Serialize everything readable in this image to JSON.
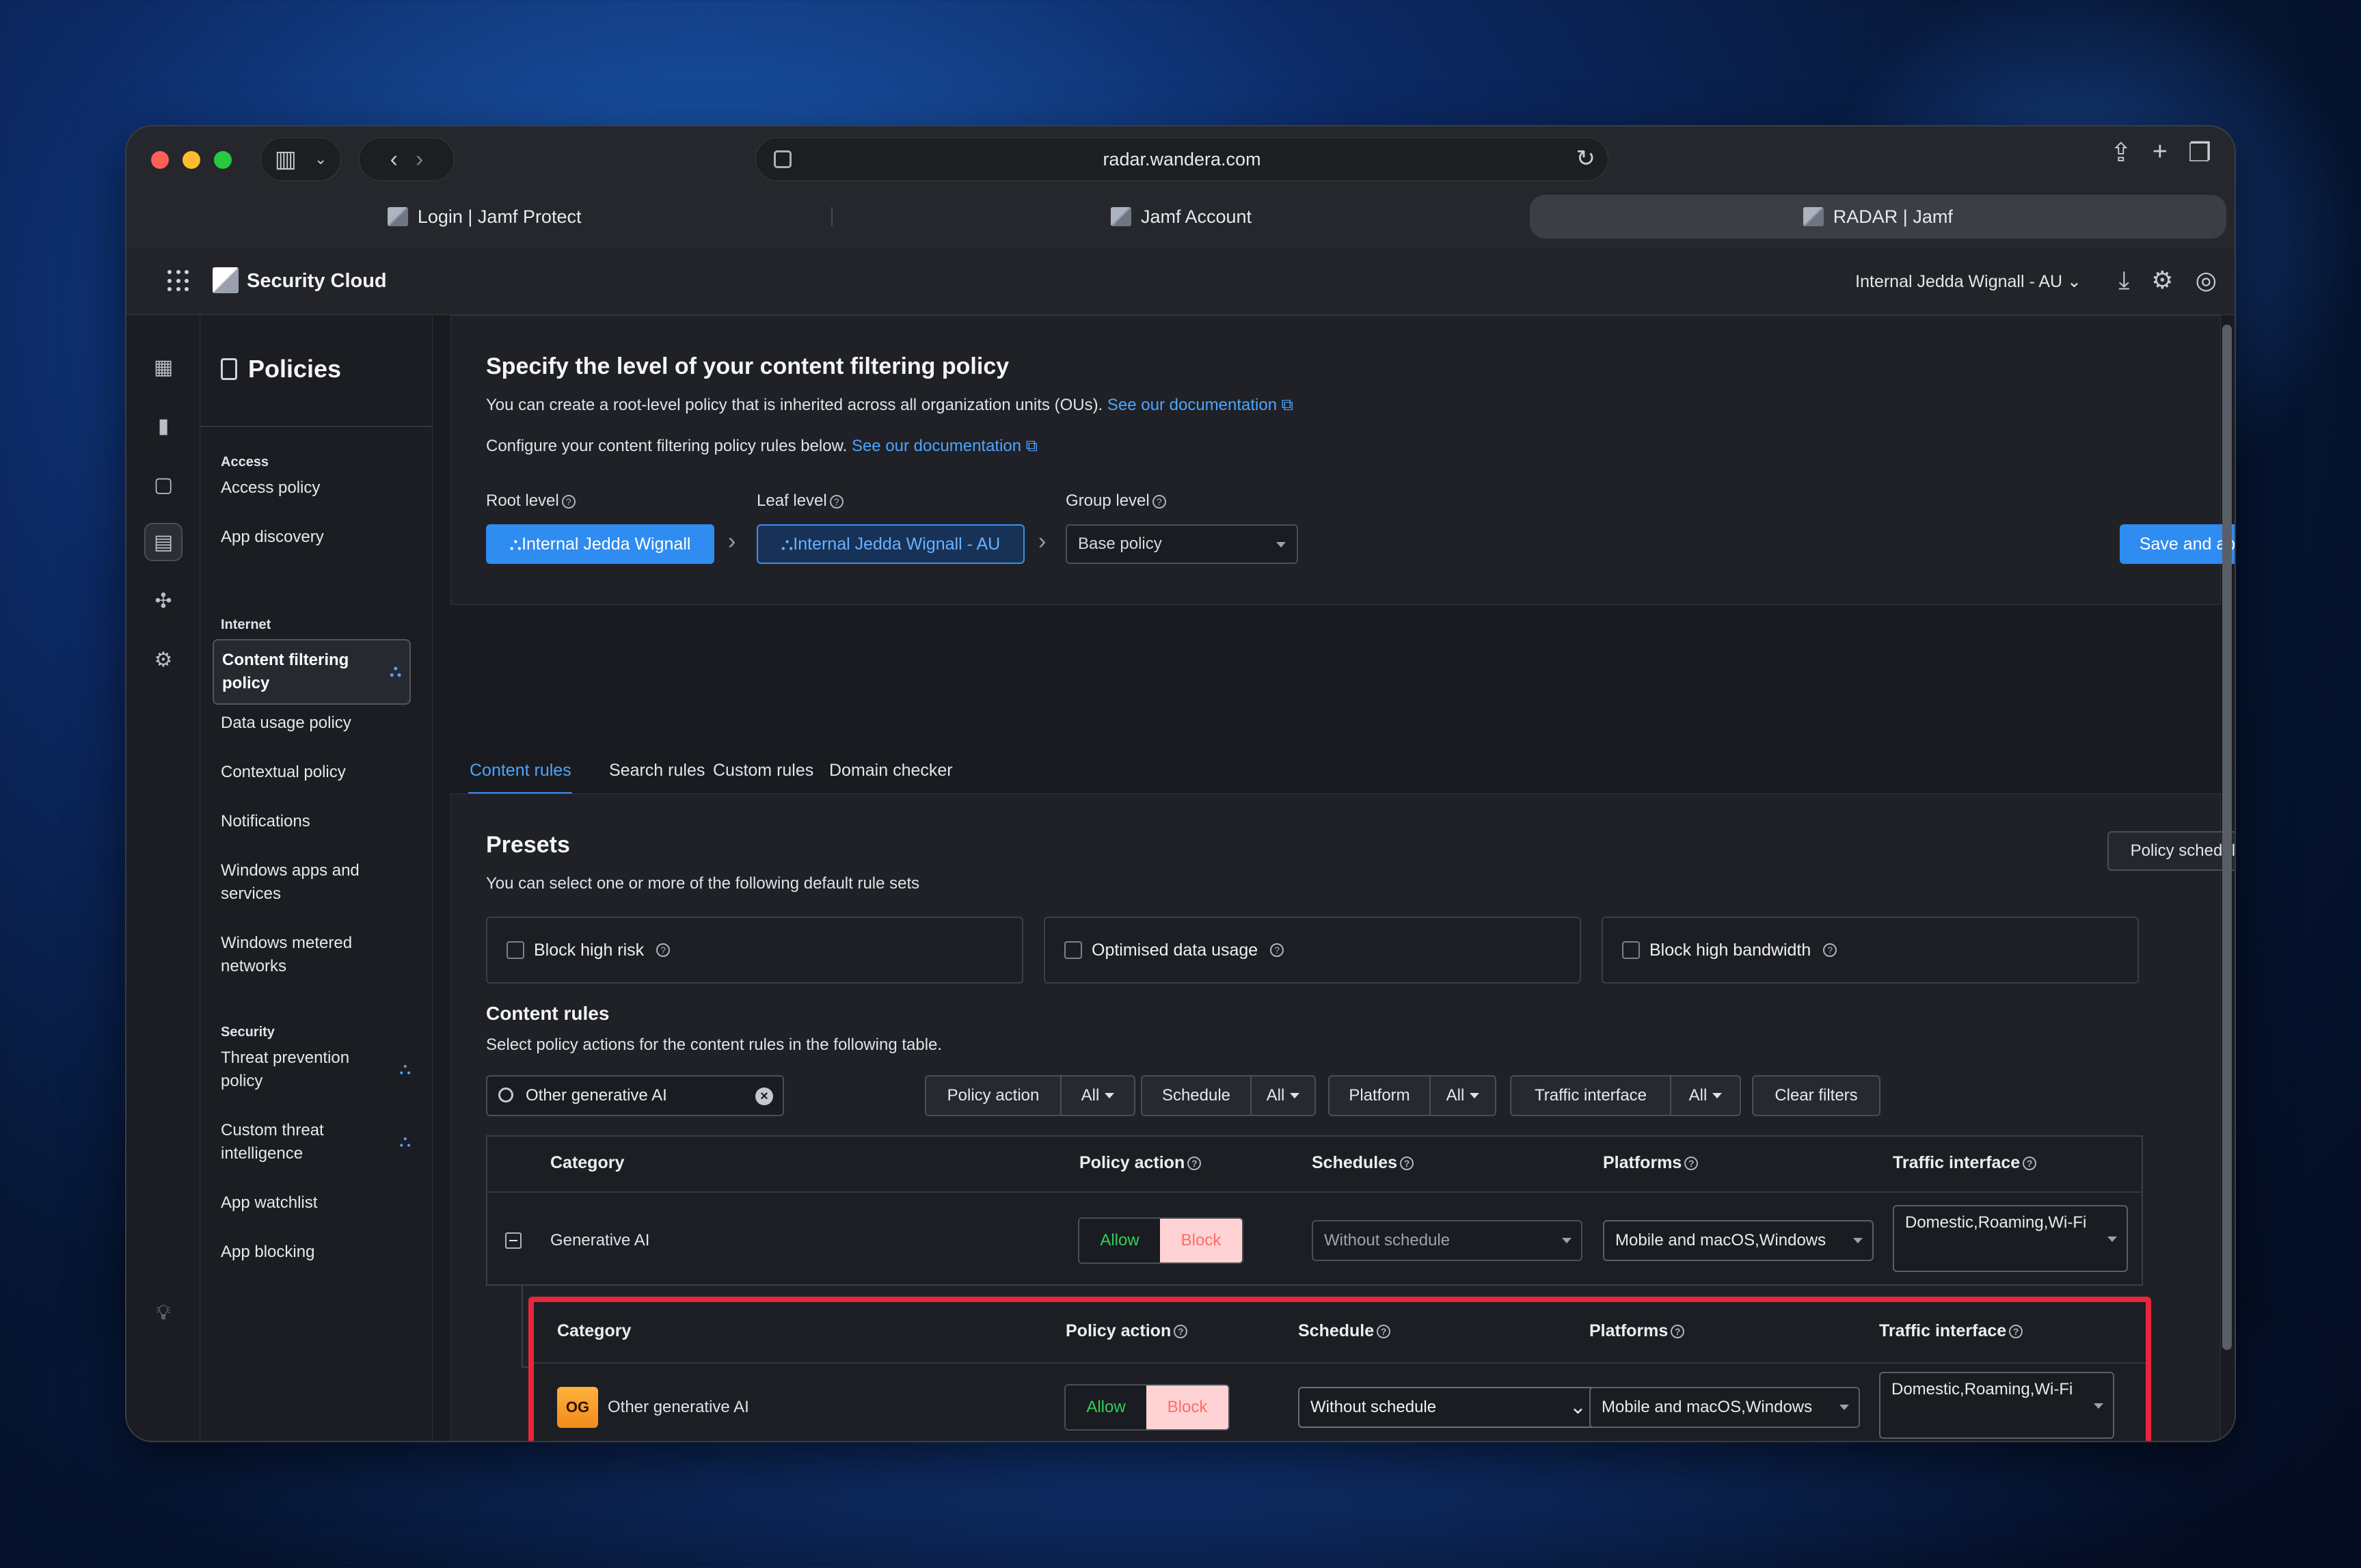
{
  "browser": {
    "url": "radar.wandera.com",
    "tabs": [
      {
        "label": "Login | Jamf Protect"
      },
      {
        "label": "Jamf Account"
      },
      {
        "label": "RADAR | Jamf"
      }
    ]
  },
  "app": {
    "brand": "Security Cloud",
    "org": "Internal Jedda Wignall - AU"
  },
  "sidebar": {
    "title": "Policies",
    "sections": [
      {
        "label": "Access",
        "items": [
          "Access policy",
          "App discovery"
        ]
      },
      {
        "label": "Internet",
        "items": [
          "Content filtering policy",
          "Data usage policy",
          "Contextual policy",
          "Notifications",
          "Windows apps and services",
          "Windows metered networks"
        ]
      },
      {
        "label": "Security",
        "items": [
          "Threat prevention policy",
          "Custom threat intelligence",
          "App watchlist",
          "App blocking"
        ]
      }
    ]
  },
  "header_card": {
    "title": "Specify the level of your content filtering policy",
    "line1": "You can create a root-level policy that is inherited across all organization units (OUs).",
    "line2": "Configure your content filtering policy rules below.",
    "doc_link": "See our documentation",
    "root_label": "Root level",
    "root_value": "Internal Jedda Wignall",
    "leaf_label": "Leaf level",
    "leaf_value": "Internal Jedda Wignall - AU",
    "group_label": "Group level",
    "group_value": "Base policy",
    "save_label": "Save and apply"
  },
  "tabs": [
    "Content rules",
    "Search rules",
    "Custom rules",
    "Domain checker"
  ],
  "presets": {
    "title": "Presets",
    "subtitle": "You can select one or more of the following default rule sets",
    "schedules_button": "Policy schedules",
    "items": [
      "Block high risk",
      "Optimised data usage",
      "Block high bandwidth"
    ]
  },
  "content_rules": {
    "title": "Content rules",
    "subtitle": "Select policy actions for the content rules in the following table.",
    "search_value": "Other generative AI",
    "filters": {
      "policy_action": "Policy action",
      "schedule": "Schedule",
      "platform": "Platform",
      "traffic": "Traffic interface",
      "all": "All",
      "clear": "Clear filters"
    },
    "columns": {
      "category": "Category",
      "policy_action": "Policy action",
      "schedules": "Schedules",
      "schedule": "Schedule",
      "platforms": "Platforms",
      "traffic": "Traffic interface"
    },
    "allow": "Allow",
    "block": "Block",
    "parent_row": {
      "category": "Generative AI",
      "schedule": "Without schedule",
      "platforms": "Mobile and macOS,Windows",
      "traffic": "Domestic,Roaming,Wi-Fi"
    },
    "child_row": {
      "badge": "OG",
      "category": "Other generative AI",
      "schedule": "Without schedule",
      "platforms": "Mobile and macOS,Windows",
      "traffic": "Domestic,Roaming,Wi-Fi"
    }
  },
  "colors": {
    "accent": "#2f8cf0",
    "highlight": "#e8263b",
    "allow": "#2fcf5b",
    "block_bg": "#ffd3d3"
  }
}
